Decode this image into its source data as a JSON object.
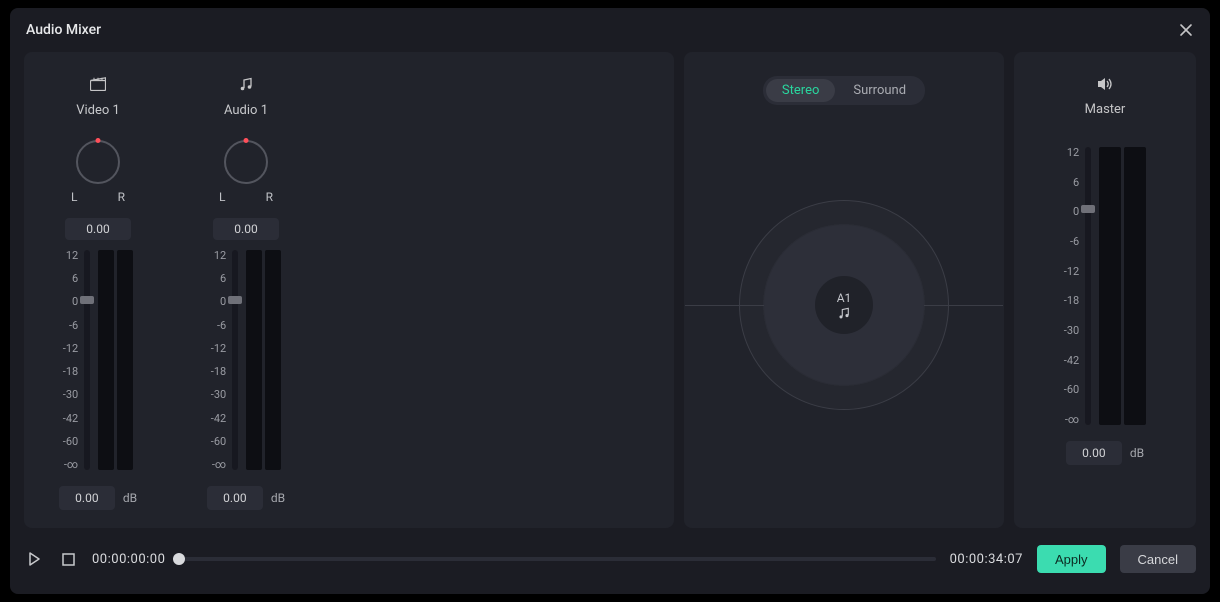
{
  "modal": {
    "title": "Audio Mixer"
  },
  "tracks": [
    {
      "icon": "clapper-icon",
      "label": "Video  1",
      "pan_l": "L",
      "pan_r": "R",
      "pan_value": "0.00",
      "gain_value": "0.00"
    },
    {
      "icon": "music-icon",
      "label": "Audio  1",
      "pan_l": "L",
      "pan_r": "R",
      "pan_value": "0.00",
      "gain_value": "0.00"
    }
  ],
  "scale_labels": [
    "12",
    "6",
    "0",
    "-6",
    "-12",
    "-18",
    "-30",
    "-42",
    "-60",
    "-∞"
  ],
  "db_label": "dB",
  "spatial": {
    "options": [
      "Stereo",
      "Surround"
    ],
    "selected": "Stereo",
    "center_label": "A1"
  },
  "master": {
    "label": "Master",
    "gain_value": "0.00"
  },
  "transport": {
    "current_time": "00:00:00:00",
    "total_time": "00:00:34:07",
    "progress_pct": 0
  },
  "buttons": {
    "apply": "Apply",
    "cancel": "Cancel"
  }
}
